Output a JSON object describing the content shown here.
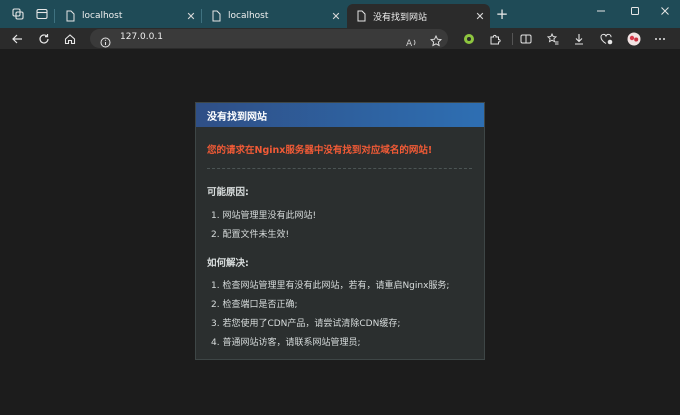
{
  "browser": {
    "tabs": [
      {
        "label": "localhost",
        "active": false
      },
      {
        "label": "localhost",
        "active": false
      },
      {
        "label": "没有找到网站",
        "active": true
      }
    ],
    "new_tab": "+",
    "address_bar": {
      "url": "127.0.0.1"
    },
    "window_controls": [
      "minimize",
      "maximize",
      "close"
    ],
    "colors": {
      "tabstrip": "#1f4b57",
      "toolbar": "#2b2b2b",
      "accent_green": "#8ec63f"
    }
  },
  "page": {
    "header": "没有找到网站",
    "alert": "您的请求在Nginx服务器中没有找到对应域名的网站!",
    "reasons": {
      "title": "可能原因:",
      "items": [
        "1. 网站管理里没有此网站!",
        "2. 配置文件未生效!"
      ]
    },
    "solutions": {
      "title": "如何解决:",
      "items": [
        "1. 检查网站管理里有没有此网站，若有，请重启Nginx服务;",
        "2. 检查端口是否正确;",
        "3. 若您使用了CDN产品，请尝试清除CDN缓存;",
        "4. 普通网站访客，请联系网站管理员;"
      ]
    },
    "colors": {
      "header": "#2e6fb3",
      "alert": "#f05a36",
      "panel": "#2b2f2f"
    }
  }
}
